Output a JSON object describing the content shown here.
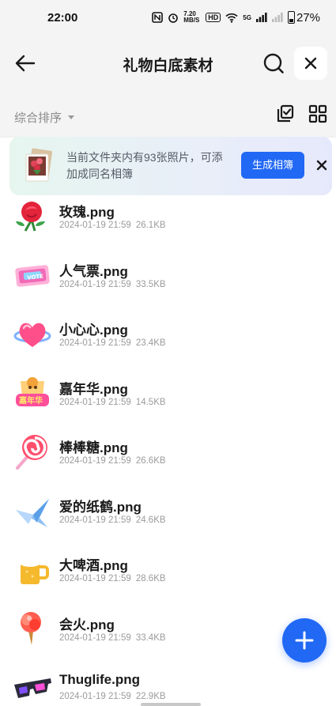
{
  "status_bar": {
    "time": "22:00",
    "net_speed": "7.20 MB/S",
    "hd_label": "HD",
    "signal_label": "5G",
    "battery": "27%"
  },
  "header": {
    "title": "礼物白底素材",
    "back_icon": "back-arrow-icon",
    "search_icon": "search-icon",
    "close_icon": "close-icon"
  },
  "sortbar": {
    "sort_label": "综合排序",
    "select_icon": "checklist-icon",
    "grid_icon": "grid-view-icon"
  },
  "banner": {
    "text": "当前文件夹内有93张照片，可添加成同名相簿",
    "button_label": "生成相簿",
    "close_icon": "close-icon"
  },
  "files": [
    {
      "name": "玫瑰.png",
      "date": "2024-01-19 21:59",
      "size": "26.1KB",
      "icon": "rose-thumbnail"
    },
    {
      "name": "人气票.png",
      "date": "2024-01-19 21:59",
      "size": "33.5KB",
      "icon": "ticket-thumbnail"
    },
    {
      "name": "小心心.png",
      "date": "2024-01-19 21:59",
      "size": "23.4KB",
      "icon": "heart-thumbnail"
    },
    {
      "name": "嘉年华.png",
      "date": "2024-01-19 21:59",
      "size": "14.5KB",
      "icon": "carnival-thumbnail"
    },
    {
      "name": "棒棒糖.png",
      "date": "2024-01-19 21:59",
      "size": "26.6KB",
      "icon": "lollipop-thumbnail"
    },
    {
      "name": "爱的纸鹤.png",
      "date": "2024-01-19 21:59",
      "size": "24.6KB",
      "icon": "paper-crane-thumbnail"
    },
    {
      "name": "大啤酒.png",
      "date": "2024-01-19 21:59",
      "size": "28.6KB",
      "icon": "beer-thumbnail"
    },
    {
      "name": "会火.png",
      "date": "2024-01-19 21:59",
      "size": "33.4KB",
      "icon": "torch-thumbnail"
    },
    {
      "name": "Thuglife.png",
      "date": "2024-01-19 21:59",
      "size": "22.9KB",
      "icon": "sunglasses-thumbnail"
    }
  ],
  "fab": {
    "icon": "plus-icon"
  },
  "colors": {
    "accent": "#2168f5",
    "background": "#f4f4f4",
    "text_primary": "#1a1a1a",
    "text_secondary": "#9b9b9b"
  }
}
